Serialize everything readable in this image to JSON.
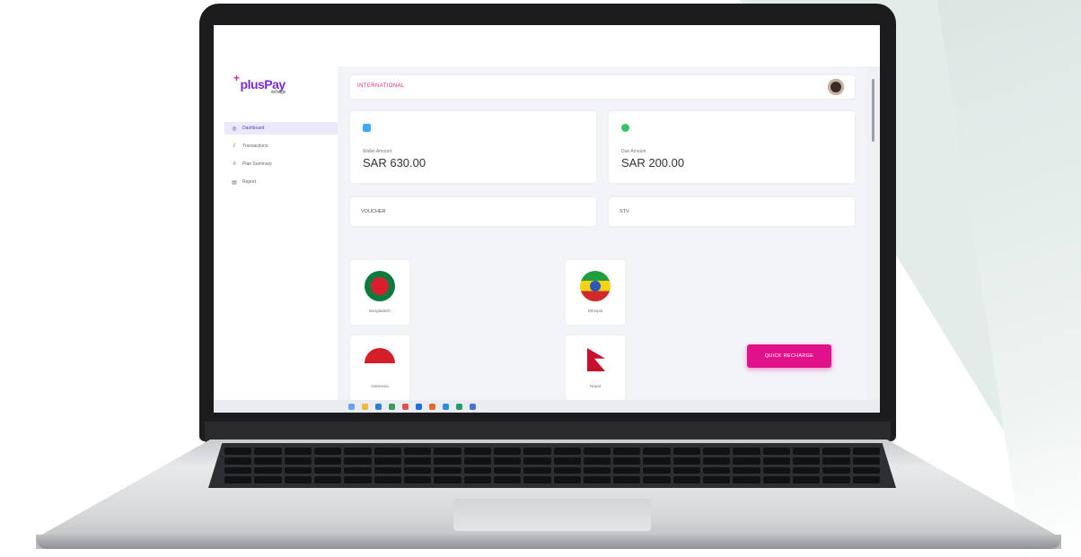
{
  "app": {
    "logo_text": "plusPay",
    "logo_sub": "recharge"
  },
  "sidebar": {
    "items": [
      {
        "label": "Dashboard",
        "icon": "dashboard-icon",
        "active": true
      },
      {
        "label": "Transactions",
        "icon": "chart-icon",
        "active": false
      },
      {
        "label": "Plan Summary",
        "icon": "list-icon",
        "active": false
      },
      {
        "label": "Report",
        "icon": "report-icon",
        "active": false
      }
    ]
  },
  "header": {
    "title": "INTERNATIONAL"
  },
  "cards": [
    {
      "label": "Wallet Amount",
      "value": "SAR 630.00",
      "icon": "wallet-icon",
      "color": "#3fa9f5"
    },
    {
      "label": "Due Amount",
      "value": "SAR 200.00",
      "icon": "due-icon",
      "color": "#35c46b"
    }
  ],
  "tabs": [
    {
      "label": "VOUCHER"
    },
    {
      "label": "STV"
    }
  ],
  "countries": [
    {
      "name": "Bangladesh",
      "flag": "bangladesh-flag"
    },
    {
      "name": "Ethiopia",
      "flag": "ethiopia-flag"
    },
    {
      "name": "Indonesia",
      "flag": "indonesia-flag"
    },
    {
      "name": "Nepal",
      "flag": "nepal-flag"
    }
  ],
  "actions": {
    "quick_recharge": "QUICK RECHARGE"
  },
  "colors": {
    "brand_pink": "#e0118a",
    "brand_purple": "#4b3bc2"
  }
}
